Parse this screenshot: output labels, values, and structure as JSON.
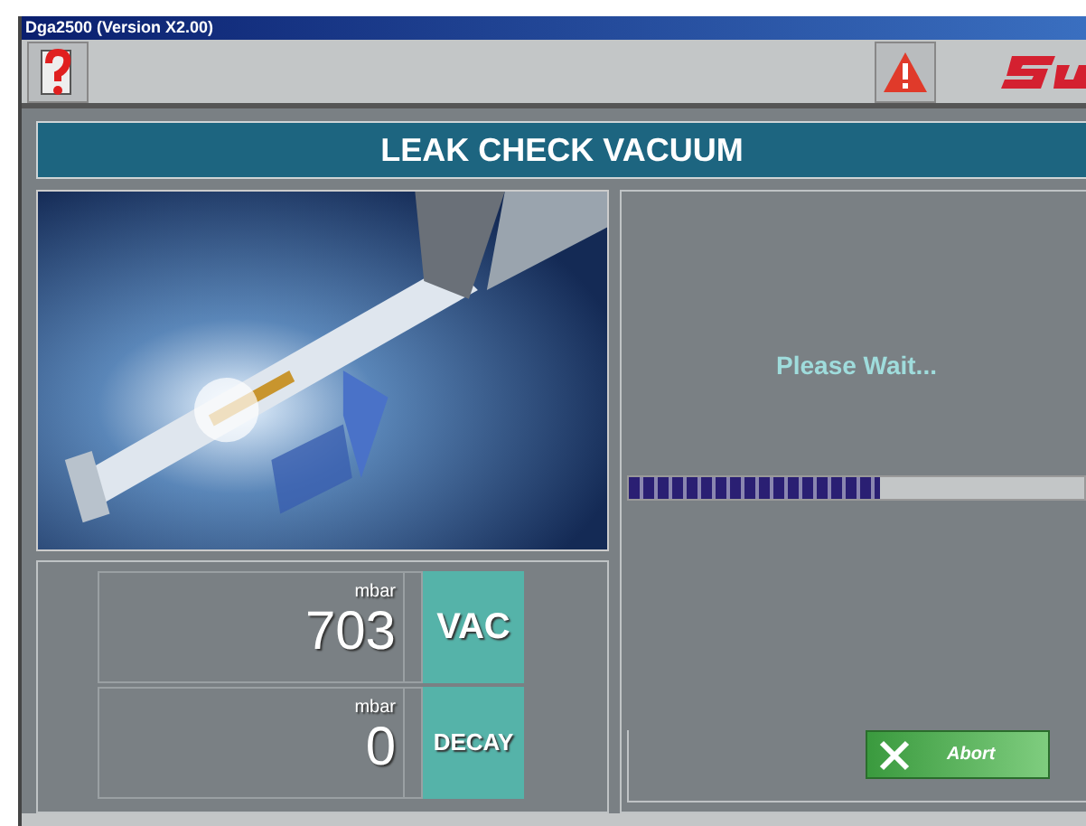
{
  "window": {
    "title": "Dga2500 (Version X2.00)"
  },
  "header": {
    "title": "LEAK CHECK VACUUM"
  },
  "readings": [
    {
      "unit": "mbar",
      "value": "703",
      "label": "VAC"
    },
    {
      "unit": "mbar",
      "value": "0",
      "label": "DECAY"
    }
  ],
  "status": {
    "message": "Please Wait...",
    "level": 0.55
  },
  "buttons": [
    {
      "label": "Abort"
    }
  ]
}
